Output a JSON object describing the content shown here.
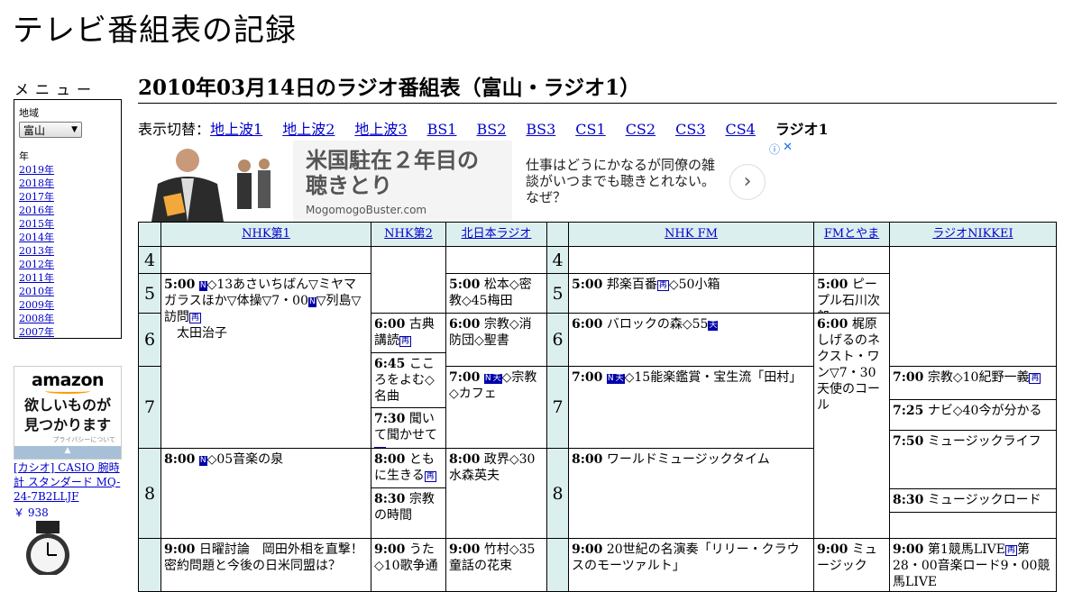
{
  "site_title": "テレビ番組表の記録",
  "menu": {
    "heading": "メニュー",
    "region_label": "地域",
    "region_value": "富山",
    "year_label": "年",
    "years": [
      "2019年",
      "2018年",
      "2017年",
      "2016年",
      "2015年",
      "2014年",
      "2013年",
      "2012年",
      "2011年",
      "2010年",
      "2009年",
      "2008年",
      "2007年"
    ]
  },
  "amazon_ad": {
    "logo": "amazon",
    "tagline_1": "欲しいものが",
    "tagline_2": "見つかります",
    "privacy": "プライバシーについて",
    "product": "[カシオ] CASIO 腕時計 スタンダード MQ-24-7B2LLJF",
    "price": "￥ 938"
  },
  "page_heading": "2010年03月14日のラジオ番組表（富山・ラジオ1）",
  "switcher": {
    "label": "表示切替：",
    "links": [
      "地上波1",
      "地上波2",
      "地上波3",
      "BS1",
      "BS2",
      "BS3",
      "CS1",
      "CS2",
      "CS3",
      "CS4"
    ],
    "current": "ラジオ1"
  },
  "banner_ad": {
    "headline": "米国駐在２年目の聴きとり",
    "domain": "MogomogoBuster.com",
    "body": "仕事はどうにかなるが同僚の雑談がいつまでも聴きとれない。なぜ？",
    "next_icon": "›",
    "info_icon": "ⓘ",
    "close_icon": "✕"
  },
  "channels": [
    "NHK第1",
    "NHK第2",
    "北日本ラジオ",
    "NHK FM",
    "FMとやま",
    "ラジオNIKKEI"
  ],
  "hours": [
    "4",
    "5",
    "6",
    "7",
    "8"
  ],
  "programs": [
    {
      "time": "5:00",
      "pre": "",
      "badge": "N",
      "text": "◇13あさいちばん▽ミヤマガラスほか▽体操▽7・00",
      "badge2": "N",
      "tail": "▽列島▽訪問",
      "r": "再",
      "extra": "　太田治子"
    },
    {
      "time": "6:00",
      "pre": "",
      "text": "古典講読",
      "r": "再"
    },
    {
      "time": "6:45",
      "text": "こころをよむ◇名曲"
    },
    {
      "time": "7:30",
      "text": "聞いて聞かせて",
      "r": "再"
    },
    {
      "time": "8:00",
      "text": "ともに生きる",
      "r": "再"
    },
    {
      "time": "8:30",
      "text": "宗教の時間"
    },
    {
      "time": "9:00",
      "text": "うた◇10歌争通"
    },
    {
      "time": "5:00",
      "text": "松本◇密教◇45梅田"
    },
    {
      "time": "6:00",
      "text": "宗教◇消防団◇聖書"
    },
    {
      "time": "7:00",
      "badge": "N",
      "badge3": "天",
      "text": "◇宗教◇カフェ"
    },
    {
      "time": "8:00",
      "text": "政界◇30水森英夫"
    },
    {
      "time": "9:00",
      "text": "竹村◇35童話の花束"
    },
    {
      "time": "5:00",
      "text": "邦楽百番",
      "r": "再",
      "text2": "◇50小箱"
    },
    {
      "time": "6:00",
      "text": "バロックの森◇55",
      "badge3": "天"
    },
    {
      "time": "7:00",
      "badge": "N",
      "badge3": "天",
      "text": "◇15能楽鑑賞・宝生流「田村」"
    },
    {
      "time": "8:00",
      "text": "ワールドミュージックタイム"
    },
    {
      "time": "9:00",
      "text": "20世紀の名演奏「リリー・クラウスのモーツァルト」"
    },
    {
      "time": "5:00",
      "text": "ピープル石川次郎"
    },
    {
      "time": "6:00",
      "text": "梶原しげるのネクスト・ワン▽7・30天使のコール"
    },
    {
      "time": "9:00",
      "text": "ミュージック"
    },
    {
      "time": "7:00",
      "text": "宗教◇10紀野一義",
      "r": "再"
    },
    {
      "time": "7:25",
      "text": "ナビ◇40今が分かる"
    },
    {
      "time": "7:50",
      "text": "ミュージックライフ"
    },
    {
      "time": "8:30",
      "text": "ミュージックロード"
    },
    {
      "time": "9:00",
      "text": "第1競馬LIVE",
      "r": "再",
      "text2": "第28・00音楽ロード9・00競馬LIVE"
    },
    {
      "time": "8:00",
      "badge": "N",
      "text": "◇05音楽の泉"
    },
    {
      "time": "9:00",
      "text": "日曜討論　岡田外相を直撃！密約問題と今後の日米同盟は？"
    }
  ]
}
